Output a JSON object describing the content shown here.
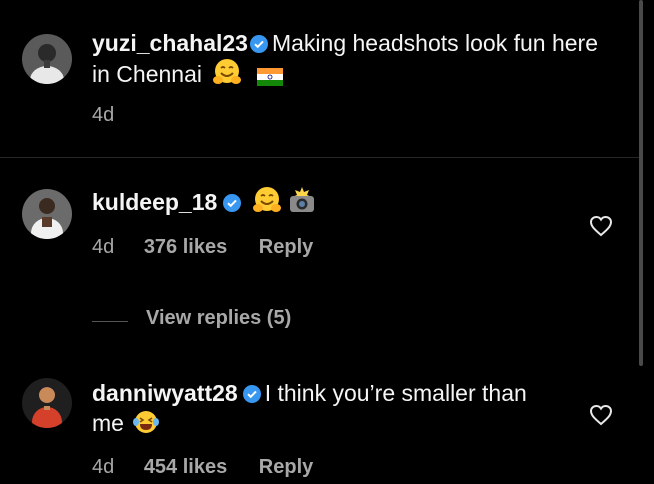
{
  "caption": {
    "username": "yuzi_chahal23",
    "text": "Making headshots look fun here",
    "text_line2": "in Chennai",
    "emojis": [
      "hugging-face-emoji",
      "india-flag-emoji"
    ],
    "time": "4d"
  },
  "comments": [
    {
      "username": "kuldeep_18",
      "emojis": [
        "hugging-face-emoji",
        "camera-flash-emoji"
      ],
      "time": "4d",
      "likes": "376 likes",
      "reply_label": "Reply"
    },
    {
      "username": "danniwyatt28",
      "text": "I think you’re smaller than",
      "text_line2": "me",
      "emojis": [
        "laughing-tears-emoji"
      ],
      "time": "4d",
      "likes": "454 likes",
      "reply_label": "Reply"
    }
  ],
  "view_replies_label": "View replies (5)",
  "colors": {
    "background": "#000000",
    "text": "#f5f5f5",
    "secondary_text": "#a8a8a8",
    "verified_badge": "#3897f0",
    "divider": "#262626"
  }
}
